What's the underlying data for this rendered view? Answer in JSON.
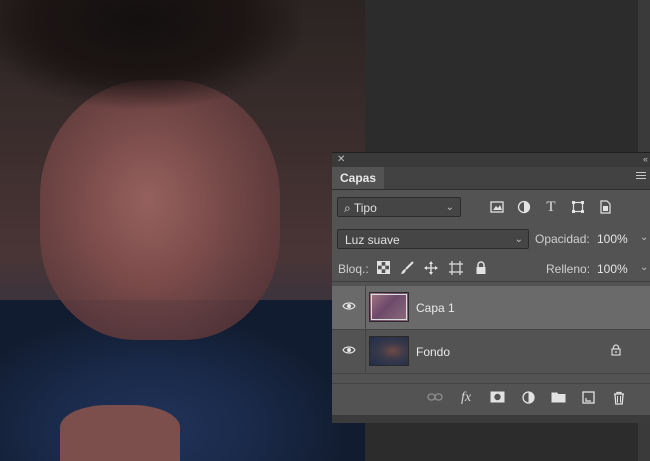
{
  "panel": {
    "tab_label": "Capas",
    "filter": {
      "value": "Tipo",
      "icon": "search-icon"
    },
    "filter_icons": [
      "image-filter-icon",
      "adjustment-filter-icon",
      "type-filter-icon",
      "shape-filter-icon",
      "smart-object-filter-icon"
    ],
    "blend_mode": "Luz suave",
    "opacity_label": "Opacidad:",
    "opacity_value": "100%",
    "lock_label": "Bloq.:",
    "lock_icons": [
      "lock-transparent-pixels-icon",
      "lock-image-pixels-icon",
      "lock-position-icon",
      "lock-artboard-icon",
      "lock-all-icon"
    ],
    "fill_label": "Relleno:",
    "fill_value": "100%",
    "layers": [
      {
        "name": "Capa 1",
        "selected": true,
        "visible": true,
        "locked": false
      },
      {
        "name": "Fondo",
        "selected": false,
        "visible": true,
        "locked": true
      }
    ],
    "footer_icons": [
      "link-layers-icon",
      "fx-icon",
      "layer-mask-icon",
      "adjustment-layer-icon",
      "new-group-icon",
      "new-layer-icon",
      "trash-icon"
    ]
  },
  "colors": {
    "panel_bg": "#535353",
    "selected_row": "#6a6a6a",
    "workspace": "#323232"
  }
}
